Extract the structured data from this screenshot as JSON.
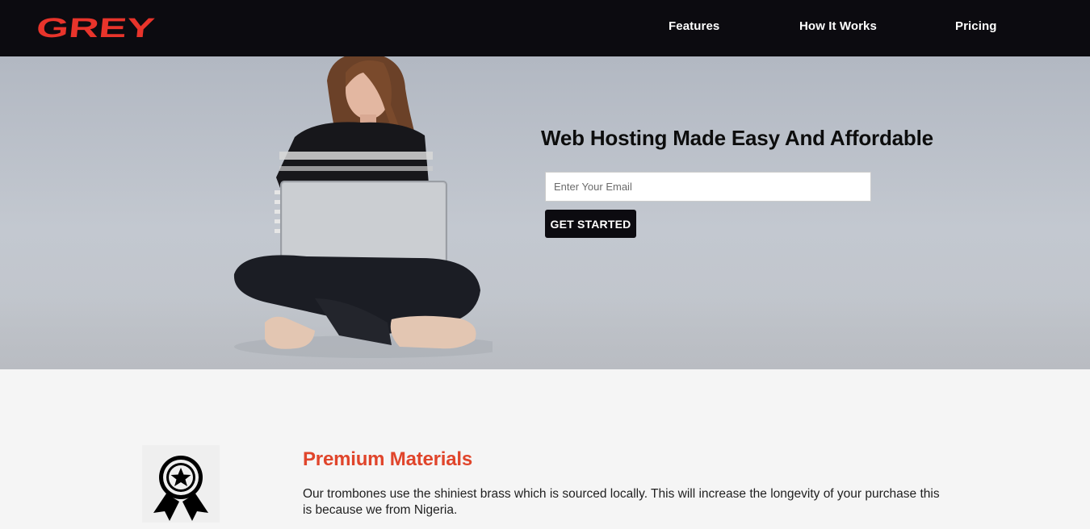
{
  "header": {
    "logo_text": "GREY",
    "nav": [
      {
        "label": "Features"
      },
      {
        "label": "How It Works"
      },
      {
        "label": "Pricing"
      }
    ]
  },
  "hero": {
    "title": "Web Hosting Made Easy And Affordable",
    "email_placeholder": "Enter Your Email",
    "cta_label": "GET STARTED"
  },
  "features": [
    {
      "icon": "award-ribbon-icon",
      "title": "Premium Materials",
      "description": "Our trombones use the shiniest brass which is sourced locally. This will increase the longevity of your purchase this is because we from Nigeria."
    }
  ],
  "colors": {
    "header_bg": "#0c0b10",
    "accent": "#e0452b",
    "logo": "#e8342b"
  }
}
